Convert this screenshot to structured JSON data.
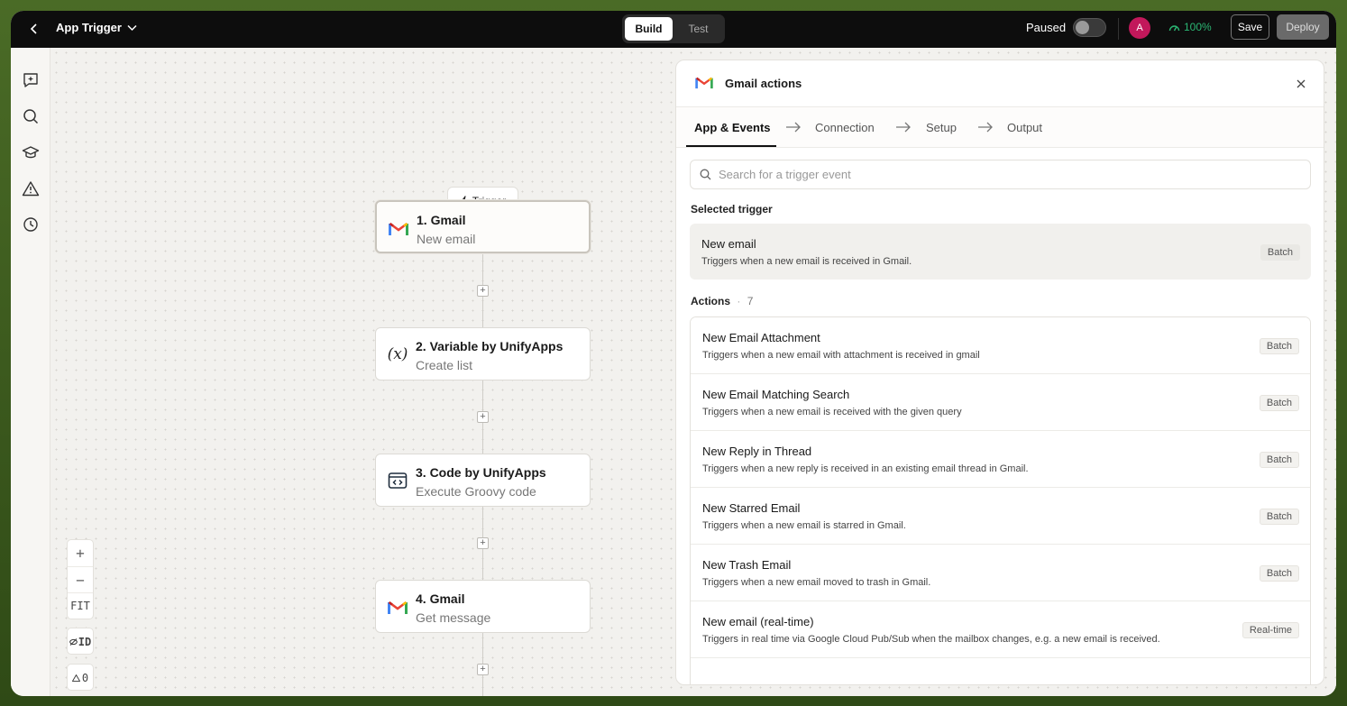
{
  "topbar": {
    "app_title": "App Trigger",
    "modes": [
      "Build",
      "Test"
    ],
    "active_mode": "Build",
    "paused_label": "Paused",
    "avatar_initial": "A",
    "health": "100%",
    "save_label": "Save",
    "deploy_label": "Deploy"
  },
  "canvas": {
    "trigger_label": "Trigger",
    "nodes": [
      {
        "title": "1. Gmail",
        "subtitle": "New email",
        "icon": "gmail-icon"
      },
      {
        "title": "2. Variable by UnifyApps",
        "subtitle": "Create list",
        "icon": "variable-icon"
      },
      {
        "title": "3. Code by UnifyApps",
        "subtitle": "Execute Groovy code",
        "icon": "code-icon"
      },
      {
        "title": "4. Gmail",
        "subtitle": "Get message",
        "icon": "gmail-icon"
      }
    ],
    "zoom": {
      "plus": "+",
      "minus": "−",
      "fit": "FIT",
      "id_toggle": "ID",
      "warnings": "0"
    }
  },
  "panel": {
    "title": "Gmail actions",
    "steps": [
      "App & Events",
      "Connection",
      "Setup",
      "Output"
    ],
    "search_placeholder": "Search for a trigger event",
    "selected_label": "Selected trigger",
    "selected": {
      "title": "New email",
      "desc": "Triggers when a new email is received in Gmail.",
      "badge": "Batch"
    },
    "actions_label": "Actions",
    "actions_sep": "·",
    "actions_count": "7",
    "actions": [
      {
        "title": "New Email Attachment",
        "desc": "Triggers when a new email with attachment is received in gmail",
        "badge": "Batch"
      },
      {
        "title": "New Email Matching Search",
        "desc": "Triggers when a new email is received with the given query",
        "badge": "Batch"
      },
      {
        "title": "New Reply in Thread",
        "desc": "Triggers when a new reply is received in an existing email thread in Gmail.",
        "badge": "Batch"
      },
      {
        "title": "New Starred Email",
        "desc": "Triggers when a new email is starred in Gmail.",
        "badge": "Batch"
      },
      {
        "title": "New Trash Email",
        "desc": "Triggers when a new email moved to trash in Gmail.",
        "badge": "Batch"
      },
      {
        "title": "New email (real-time)",
        "desc": "Triggers in real time via Google Cloud Pub/Sub when the mailbox changes, e.g. a new email is received.",
        "badge": "Real-time"
      }
    ]
  },
  "colors": {
    "accent": "#0d0d0d",
    "health": "#2bb673",
    "avatar": "#c2185b"
  }
}
